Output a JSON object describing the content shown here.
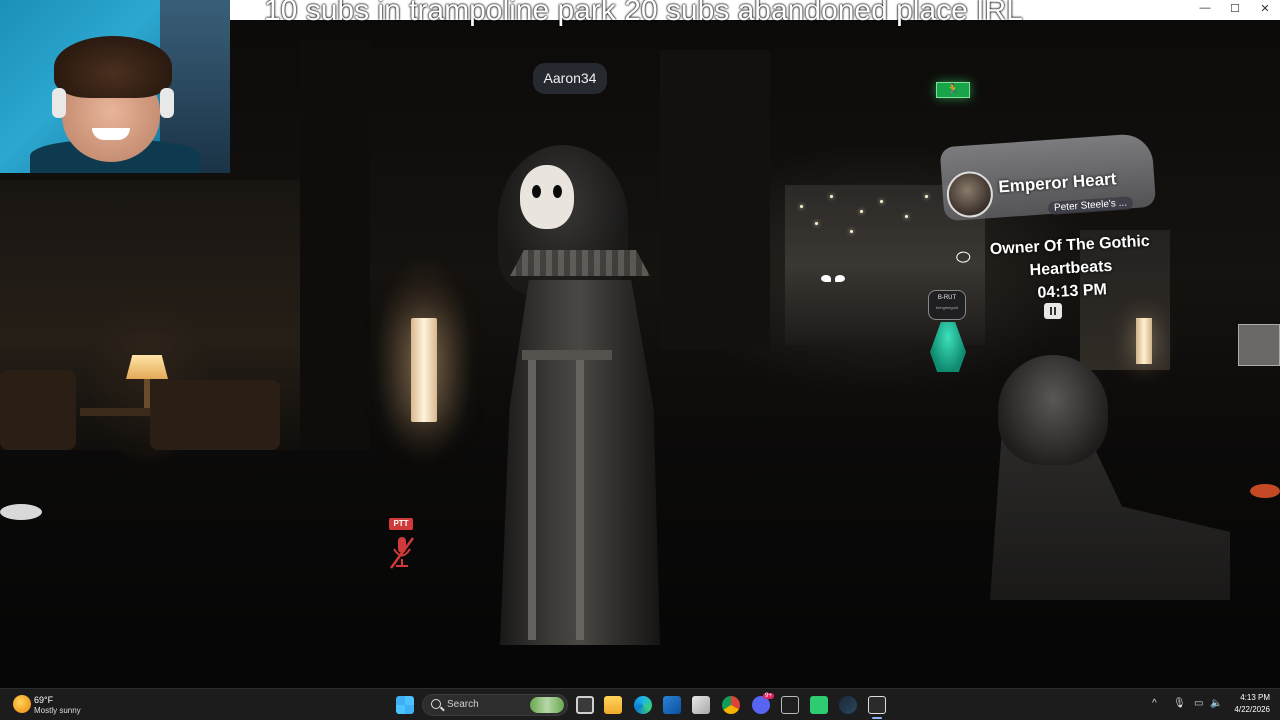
{
  "stream_overlay": {
    "caption": "10 subs in trampoline park 20 subs abandoned place IRL"
  },
  "scene": {
    "nameplate": "Aaron34",
    "exit_sign": "🏃",
    "small_tag_name": "B-RUT",
    "small_tag_sub": "bringmegold",
    "music_widget": {
      "title": "Emperor Heart",
      "artist": "Peter Steele's ..."
    },
    "status": {
      "line1": "Owner Of The Gothic",
      "line2": "Heartbeats",
      "time": "04:13 PM"
    },
    "ptt_label": "PTT"
  },
  "window_controls": {
    "minimize": "—",
    "maximize": "☐",
    "close": "✕"
  },
  "taskbar": {
    "weather": {
      "temp": "69°F",
      "desc": "Mostly sunny"
    },
    "search_placeholder": "Search",
    "apps": [
      "file-explorer",
      "edge",
      "outlook",
      "store",
      "chrome",
      "discord",
      "steam-app",
      "app-green",
      "steam",
      "vrchat"
    ],
    "discord_badge": "9+",
    "clock": {
      "time": "4:13 PM",
      "date": "4/22/2026"
    }
  }
}
